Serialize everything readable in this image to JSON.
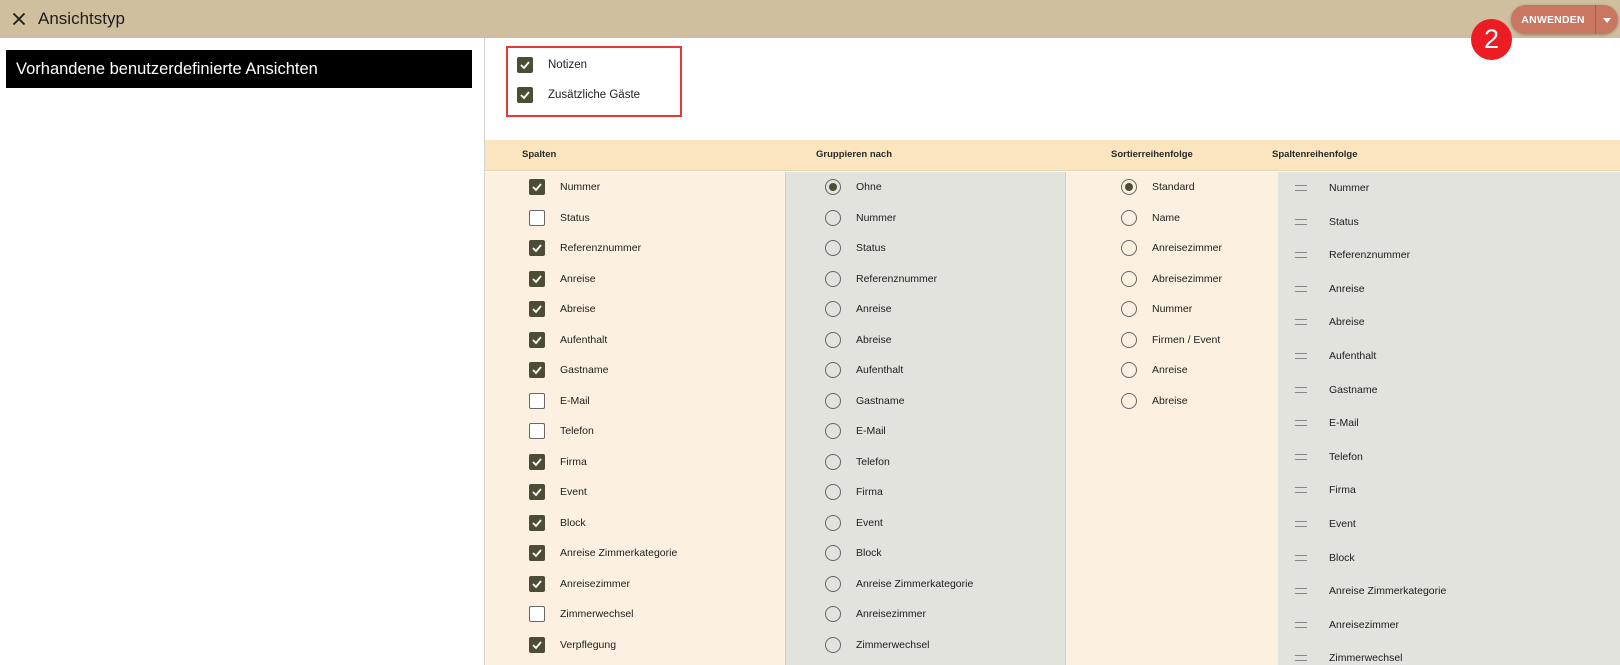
{
  "header": {
    "title": "Ansichtstyp",
    "apply_label": "ANWENDEN",
    "badge": "2",
    "accent_color": "#c97760",
    "bar_color": "#cfbf9e"
  },
  "left": {
    "title": "Vorhandene benutzerdefinierte Ansichten"
  },
  "options": [
    {
      "label": "Notizen",
      "checked": true
    },
    {
      "label": "Zusätzliche Gäste",
      "checked": true
    }
  ],
  "columns_header": {
    "spalten": "Spalten",
    "gruppieren": "Gruppieren nach",
    "sortier": "Sortierreihenfolge",
    "spaltenreihenfolge": "Spaltenreihenfolge"
  },
  "spalten": [
    {
      "label": "Nummer",
      "checked": true
    },
    {
      "label": "Status",
      "checked": false
    },
    {
      "label": "Referenznummer",
      "checked": true
    },
    {
      "label": "Anreise",
      "checked": true
    },
    {
      "label": "Abreise",
      "checked": true
    },
    {
      "label": "Aufenthalt",
      "checked": true
    },
    {
      "label": "Gastname",
      "checked": true
    },
    {
      "label": "E-Mail",
      "checked": false
    },
    {
      "label": "Telefon",
      "checked": false
    },
    {
      "label": "Firma",
      "checked": true
    },
    {
      "label": "Event",
      "checked": true
    },
    {
      "label": "Block",
      "checked": true
    },
    {
      "label": "Anreise Zimmerkategorie",
      "checked": true
    },
    {
      "label": "Anreisezimmer",
      "checked": true
    },
    {
      "label": "Zimmerwechsel",
      "checked": false
    },
    {
      "label": "Verpflegung",
      "checked": true
    }
  ],
  "gruppieren": {
    "selected": "Ohne",
    "options": [
      "Ohne",
      "Nummer",
      "Status",
      "Referenznummer",
      "Anreise",
      "Abreise",
      "Aufenthalt",
      "Gastname",
      "E-Mail",
      "Telefon",
      "Firma",
      "Event",
      "Block",
      "Anreise Zimmerkategorie",
      "Anreisezimmer",
      "Zimmerwechsel"
    ]
  },
  "sortier": {
    "selected": "Standard",
    "options": [
      "Standard",
      "Name",
      "Anreisezimmer",
      "Abreisezimmer",
      "Nummer",
      "Firmen / Event",
      "Anreise",
      "Abreise"
    ]
  },
  "spaltenreihenfolge": [
    "Nummer",
    "Status",
    "Referenznummer",
    "Anreise",
    "Abreise",
    "Aufenthalt",
    "Gastname",
    "E-Mail",
    "Telefon",
    "Firma",
    "Event",
    "Block",
    "Anreise Zimmerkategorie",
    "Anreisezimmer",
    "Zimmerwechsel"
  ]
}
